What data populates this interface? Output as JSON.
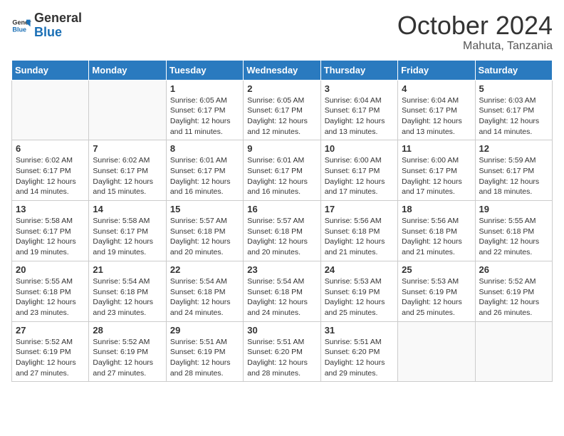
{
  "header": {
    "logo_general": "General",
    "logo_blue": "Blue",
    "month": "October 2024",
    "location": "Mahuta, Tanzania"
  },
  "days_of_week": [
    "Sunday",
    "Monday",
    "Tuesday",
    "Wednesday",
    "Thursday",
    "Friday",
    "Saturday"
  ],
  "weeks": [
    [
      {
        "day": "",
        "info": ""
      },
      {
        "day": "",
        "info": ""
      },
      {
        "day": "1",
        "info": "Sunrise: 6:05 AM\nSunset: 6:17 PM\nDaylight: 12 hours and 11 minutes."
      },
      {
        "day": "2",
        "info": "Sunrise: 6:05 AM\nSunset: 6:17 PM\nDaylight: 12 hours and 12 minutes."
      },
      {
        "day": "3",
        "info": "Sunrise: 6:04 AM\nSunset: 6:17 PM\nDaylight: 12 hours and 13 minutes."
      },
      {
        "day": "4",
        "info": "Sunrise: 6:04 AM\nSunset: 6:17 PM\nDaylight: 12 hours and 13 minutes."
      },
      {
        "day": "5",
        "info": "Sunrise: 6:03 AM\nSunset: 6:17 PM\nDaylight: 12 hours and 14 minutes."
      }
    ],
    [
      {
        "day": "6",
        "info": "Sunrise: 6:02 AM\nSunset: 6:17 PM\nDaylight: 12 hours and 14 minutes."
      },
      {
        "day": "7",
        "info": "Sunrise: 6:02 AM\nSunset: 6:17 PM\nDaylight: 12 hours and 15 minutes."
      },
      {
        "day": "8",
        "info": "Sunrise: 6:01 AM\nSunset: 6:17 PM\nDaylight: 12 hours and 16 minutes."
      },
      {
        "day": "9",
        "info": "Sunrise: 6:01 AM\nSunset: 6:17 PM\nDaylight: 12 hours and 16 minutes."
      },
      {
        "day": "10",
        "info": "Sunrise: 6:00 AM\nSunset: 6:17 PM\nDaylight: 12 hours and 17 minutes."
      },
      {
        "day": "11",
        "info": "Sunrise: 6:00 AM\nSunset: 6:17 PM\nDaylight: 12 hours and 17 minutes."
      },
      {
        "day": "12",
        "info": "Sunrise: 5:59 AM\nSunset: 6:17 PM\nDaylight: 12 hours and 18 minutes."
      }
    ],
    [
      {
        "day": "13",
        "info": "Sunrise: 5:58 AM\nSunset: 6:17 PM\nDaylight: 12 hours and 19 minutes."
      },
      {
        "day": "14",
        "info": "Sunrise: 5:58 AM\nSunset: 6:17 PM\nDaylight: 12 hours and 19 minutes."
      },
      {
        "day": "15",
        "info": "Sunrise: 5:57 AM\nSunset: 6:18 PM\nDaylight: 12 hours and 20 minutes."
      },
      {
        "day": "16",
        "info": "Sunrise: 5:57 AM\nSunset: 6:18 PM\nDaylight: 12 hours and 20 minutes."
      },
      {
        "day": "17",
        "info": "Sunrise: 5:56 AM\nSunset: 6:18 PM\nDaylight: 12 hours and 21 minutes."
      },
      {
        "day": "18",
        "info": "Sunrise: 5:56 AM\nSunset: 6:18 PM\nDaylight: 12 hours and 21 minutes."
      },
      {
        "day": "19",
        "info": "Sunrise: 5:55 AM\nSunset: 6:18 PM\nDaylight: 12 hours and 22 minutes."
      }
    ],
    [
      {
        "day": "20",
        "info": "Sunrise: 5:55 AM\nSunset: 6:18 PM\nDaylight: 12 hours and 23 minutes."
      },
      {
        "day": "21",
        "info": "Sunrise: 5:54 AM\nSunset: 6:18 PM\nDaylight: 12 hours and 23 minutes."
      },
      {
        "day": "22",
        "info": "Sunrise: 5:54 AM\nSunset: 6:18 PM\nDaylight: 12 hours and 24 minutes."
      },
      {
        "day": "23",
        "info": "Sunrise: 5:54 AM\nSunset: 6:18 PM\nDaylight: 12 hours and 24 minutes."
      },
      {
        "day": "24",
        "info": "Sunrise: 5:53 AM\nSunset: 6:19 PM\nDaylight: 12 hours and 25 minutes."
      },
      {
        "day": "25",
        "info": "Sunrise: 5:53 AM\nSunset: 6:19 PM\nDaylight: 12 hours and 25 minutes."
      },
      {
        "day": "26",
        "info": "Sunrise: 5:52 AM\nSunset: 6:19 PM\nDaylight: 12 hours and 26 minutes."
      }
    ],
    [
      {
        "day": "27",
        "info": "Sunrise: 5:52 AM\nSunset: 6:19 PM\nDaylight: 12 hours and 27 minutes."
      },
      {
        "day": "28",
        "info": "Sunrise: 5:52 AM\nSunset: 6:19 PM\nDaylight: 12 hours and 27 minutes."
      },
      {
        "day": "29",
        "info": "Sunrise: 5:51 AM\nSunset: 6:19 PM\nDaylight: 12 hours and 28 minutes."
      },
      {
        "day": "30",
        "info": "Sunrise: 5:51 AM\nSunset: 6:20 PM\nDaylight: 12 hours and 28 minutes."
      },
      {
        "day": "31",
        "info": "Sunrise: 5:51 AM\nSunset: 6:20 PM\nDaylight: 12 hours and 29 minutes."
      },
      {
        "day": "",
        "info": ""
      },
      {
        "day": "",
        "info": ""
      }
    ]
  ]
}
